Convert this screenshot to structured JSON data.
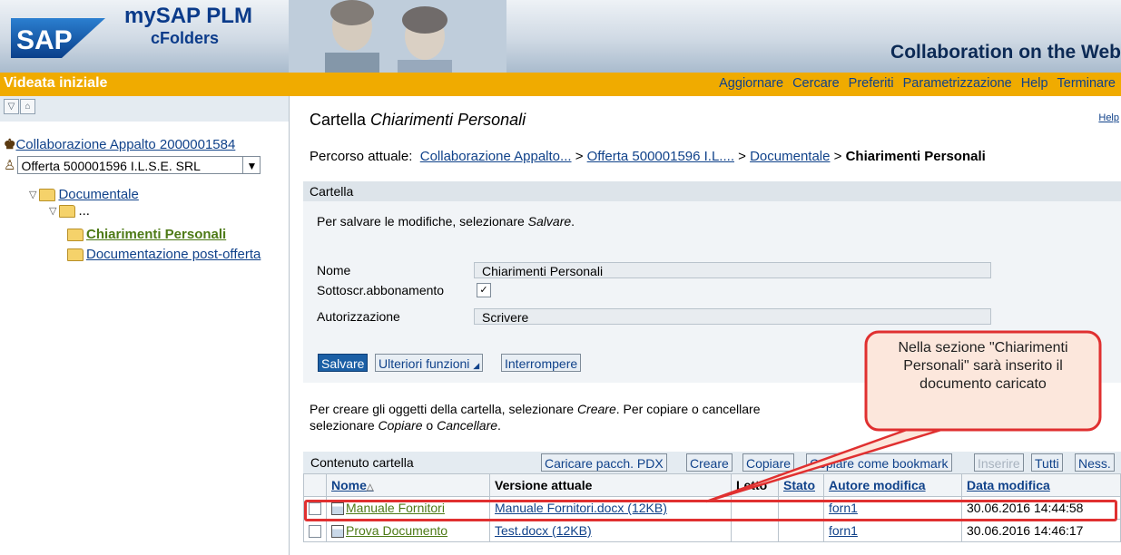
{
  "header": {
    "brand": "SAP",
    "product_line1": "mySAP PLM",
    "product_line2": "cFolders",
    "tagline": "Collaboration on the Web"
  },
  "nav": {
    "title": "Videata iniziale",
    "links": [
      "Aggiornare",
      "Cercare",
      "Preferiti",
      "Parametrizzazione",
      "Help",
      "Terminare"
    ]
  },
  "tree": {
    "root": "Collaborazione Appalto 2000001584",
    "offer_select": "Offerta 500001596 I.L.S.E. SRL",
    "nodes": {
      "documentale": "Documentale",
      "ellipsis": "...",
      "chiarimenti": "Chiarimenti Personali",
      "postofferta": "Documentazione post-offerta"
    }
  },
  "main": {
    "title_prefix": "Cartella ",
    "title_name": "Chiarimenti Personali",
    "help": "Help",
    "breadcrumb": {
      "label": "Percorso attuale:",
      "items": [
        "Collaborazione Appalto...",
        "Offerta 500001596 I.L....",
        "Documentale"
      ],
      "sep": ">",
      "current": "Chiarimenti Personali"
    }
  },
  "folder_section": {
    "header": "Cartella",
    "save_hint_prefix": "Per salvare le modifiche, selezionare ",
    "save_hint_action": "Salvare",
    "save_hint_suffix": ".",
    "fields": {
      "nome_label": "Nome",
      "nome_value": "Chiarimenti Personali",
      "abbonamento_label": "Sottoscr.abbonamento",
      "abbonamento_checked": true,
      "autorizzazione_label": "Autorizzazione",
      "autorizzazione_value": "Scrivere"
    },
    "buttons": {
      "save": "Salvare",
      "more": "Ulteriori funzioni",
      "cancel": "Interrompere"
    }
  },
  "create_hint": {
    "p1": "Per creare gli oggetti della cartella, selezionare ",
    "creare": "Creare",
    "p2": ". Per copiare o cancellare",
    "p3": "selezionare ",
    "copiare": "Copiare",
    "o": " o ",
    "cancellare": "Cancellare",
    "p4": "."
  },
  "contents": {
    "caption": "Contenuto cartella",
    "toolbar": [
      "Caricare pacch. PDX",
      "Creare",
      "Copiare",
      "Copiare come bookmark",
      "Inserire",
      "Tutti",
      "Ness."
    ],
    "columns": [
      "Nome",
      "Versione attuale",
      "Letto",
      "Stato",
      "Autore modifica",
      "Data modifica"
    ],
    "rows": [
      {
        "name": "Manuale Fornitori",
        "version": "Manuale Fornitori.docx (12KB)",
        "letto": "",
        "stato": "",
        "author": "forn1",
        "date": "30.06.2016 14:44:58"
      },
      {
        "name": "Prova Documento",
        "version": "Test.docx (12KB)",
        "letto": "",
        "stato": "",
        "author": "forn1",
        "date": "30.06.2016 14:46:17"
      }
    ]
  },
  "callout": {
    "text": "Nella sezione \"Chiarimenti Personali\" sarà inserito il documento caricato"
  },
  "colors": {
    "nav_bar": "#f0ab00",
    "link": "#10428a",
    "primary_button": "#1b5fa5",
    "highlight": "#e03030"
  }
}
